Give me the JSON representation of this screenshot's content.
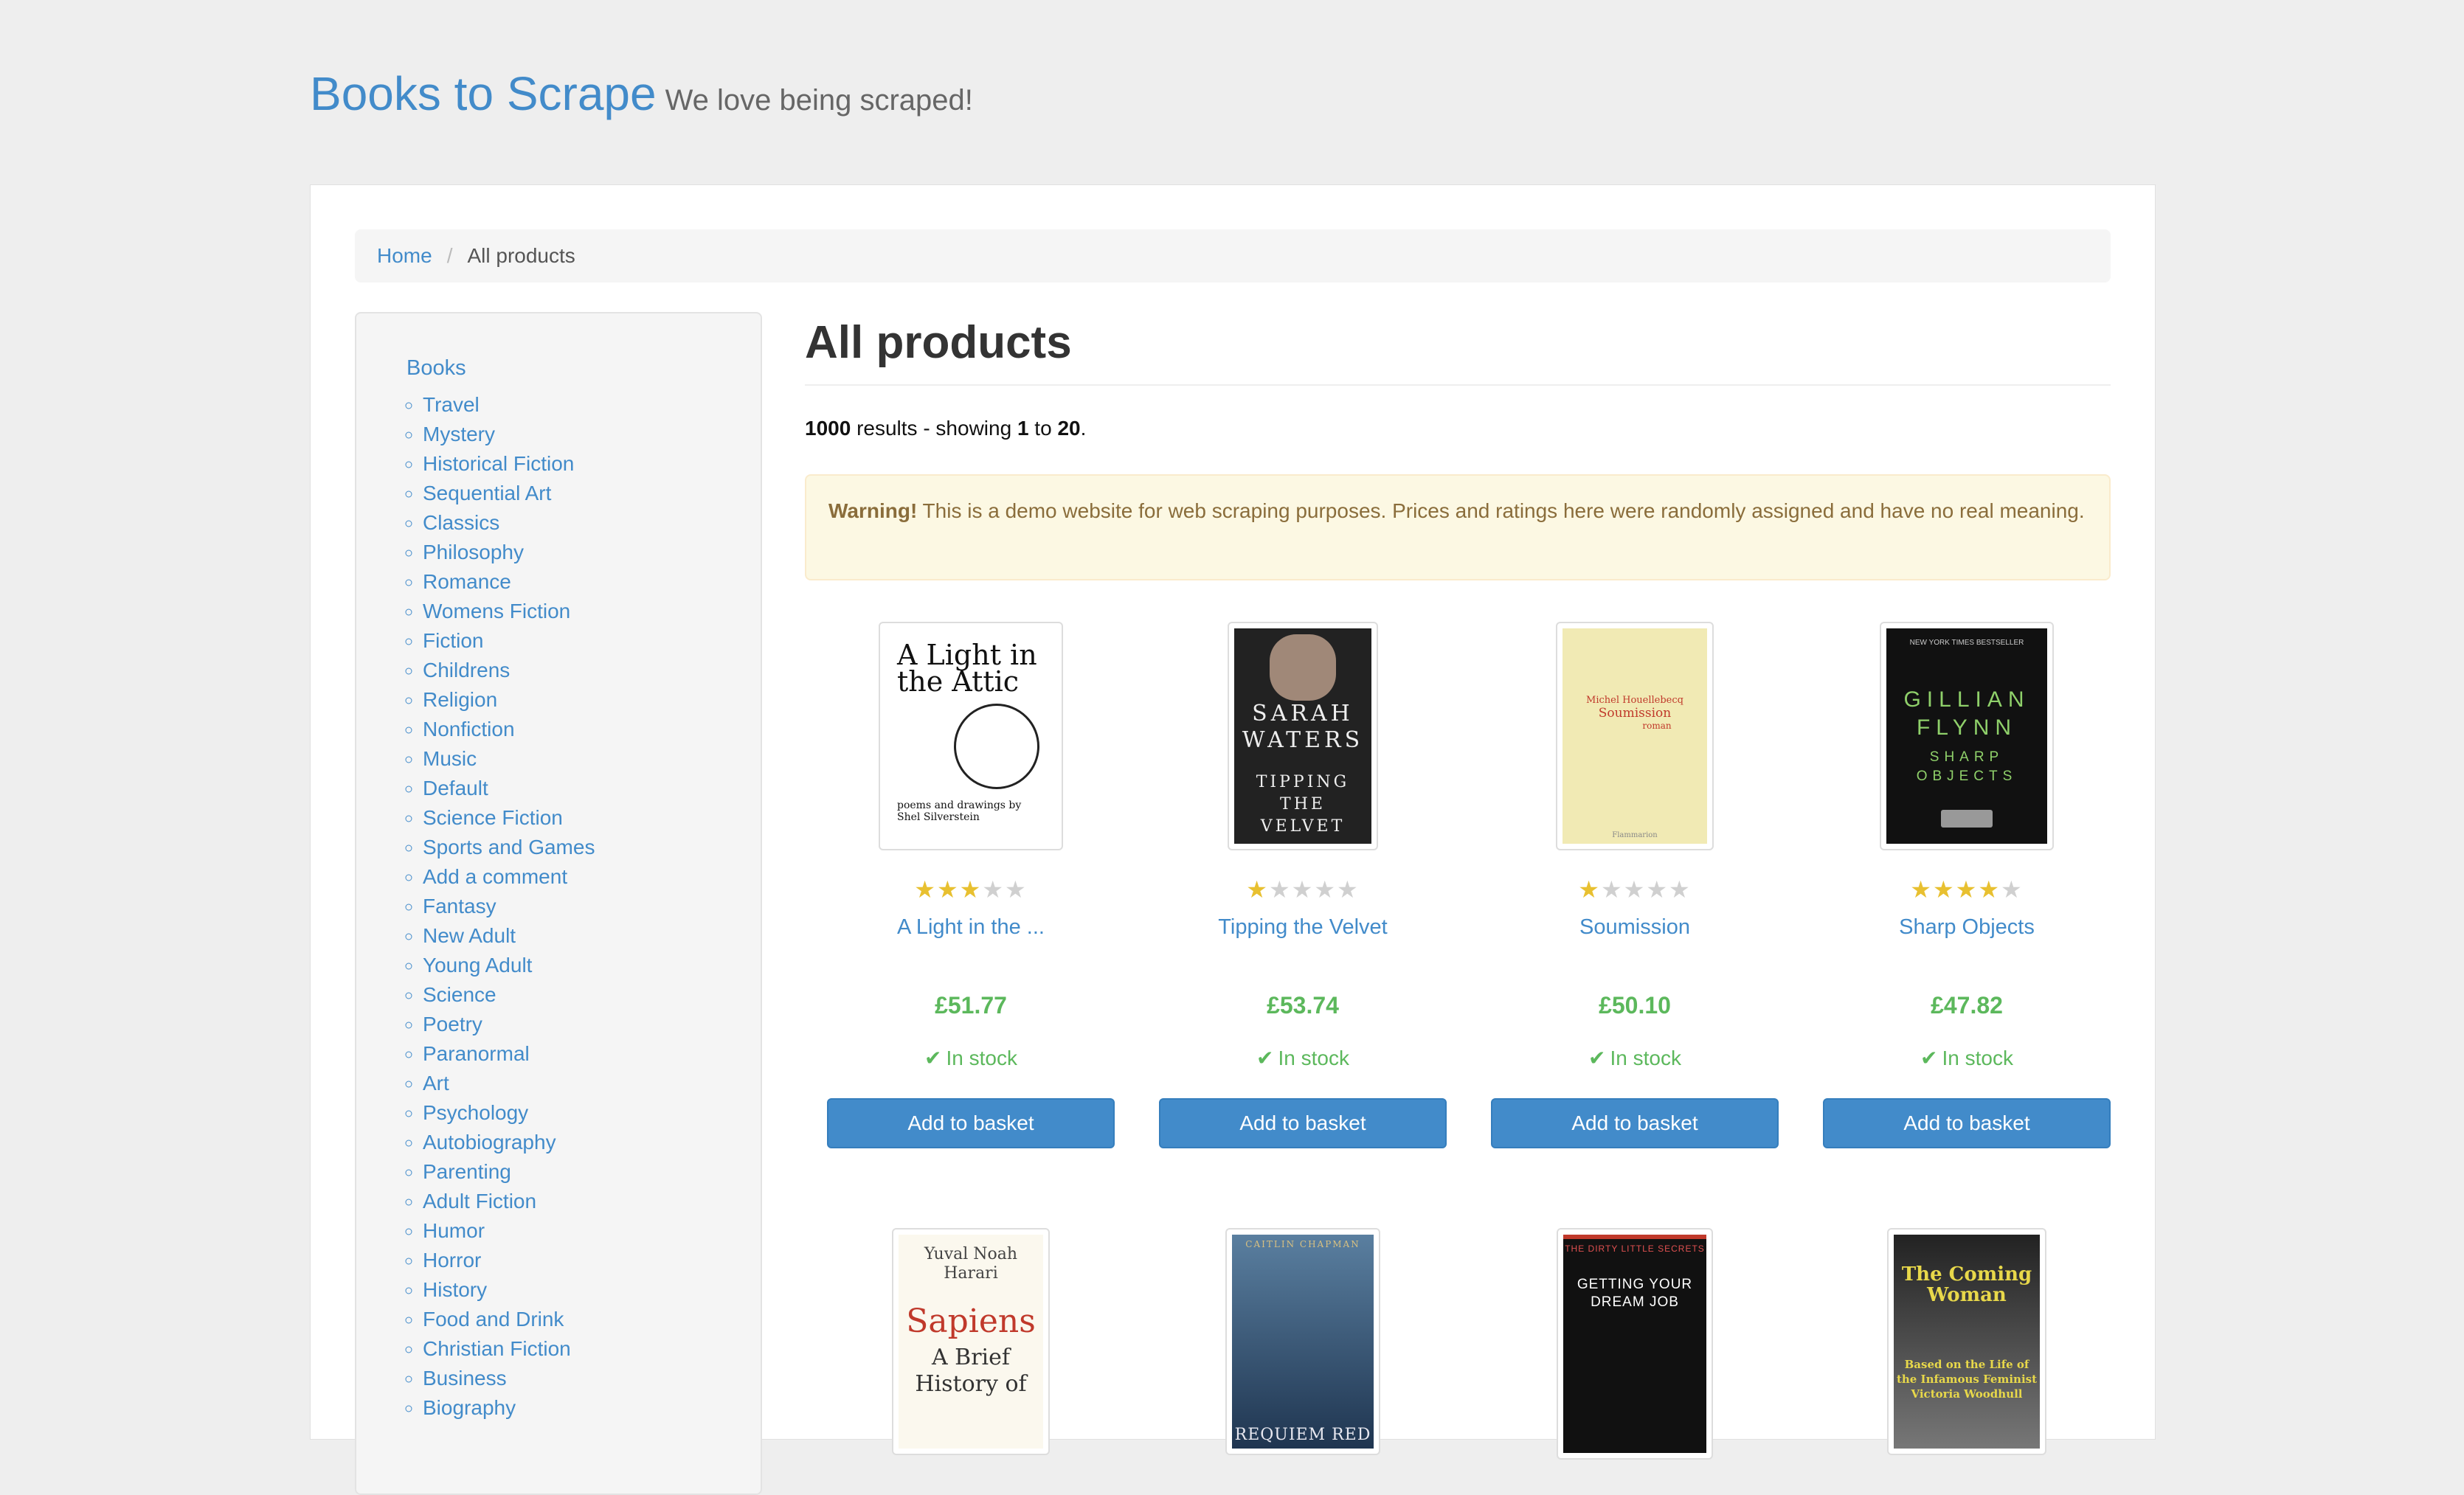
{
  "header": {
    "brand": "Books to Scrape",
    "tagline": "We love being scraped!"
  },
  "breadcrumb": {
    "home": "Home",
    "separator": "/",
    "current": "All products"
  },
  "sidebar": {
    "root": "Books",
    "categories": [
      "Travel",
      "Mystery",
      "Historical Fiction",
      "Sequential Art",
      "Classics",
      "Philosophy",
      "Romance",
      "Womens Fiction",
      "Fiction",
      "Childrens",
      "Religion",
      "Nonfiction",
      "Music",
      "Default",
      "Science Fiction",
      "Sports and Games",
      "Add a comment",
      "Fantasy",
      "New Adult",
      "Young Adult",
      "Science",
      "Poetry",
      "Paranormal",
      "Art",
      "Psychology",
      "Autobiography",
      "Parenting",
      "Adult Fiction",
      "Humor",
      "Horror",
      "History",
      "Food and Drink",
      "Christian Fiction",
      "Business",
      "Biography"
    ]
  },
  "main": {
    "title": "All products",
    "results": {
      "total": "1000",
      "text1": " results - showing ",
      "from": "1",
      "text2": " to ",
      "to": "20",
      "end": "."
    },
    "warning": {
      "label": "Warning!",
      "text": " This is a demo website for web scraping purposes. Prices and ratings here were randomly assigned and have no real meaning."
    }
  },
  "colors": {
    "link": "#428bca",
    "price": "#5cb85c",
    "star": "#e8c030",
    "warning_bg": "#fcf8e3"
  },
  "products": [
    {
      "title": "A Light in the ...",
      "rating": 3,
      "price": "£51.77",
      "stock": "In stock",
      "button": "Add to basket",
      "cover": {
        "lines": [
          "A Light in the Attic",
          "poems and drawings by Shel Silverstein"
        ]
      }
    },
    {
      "title": "Tipping the Velvet",
      "rating": 1,
      "price": "£53.74",
      "stock": "In stock",
      "button": "Add to basket",
      "cover": {
        "lines": [
          "SARAH WATERS",
          "TIPPING THE VELVET"
        ]
      }
    },
    {
      "title": "Soumission",
      "rating": 1,
      "price": "£50.10",
      "stock": "In stock",
      "button": "Add to basket",
      "cover": {
        "lines": [
          "Michel Houellebecq",
          "Soumission",
          "roman",
          "Flammarion"
        ]
      }
    },
    {
      "title": "Sharp Objects",
      "rating": 4,
      "price": "£47.82",
      "stock": "In stock",
      "button": "Add to basket",
      "cover": {
        "lines": [
          "NEW YORK TIMES BESTSELLER",
          "GILLIAN FLYNN",
          "SHARP OBJECTS"
        ]
      }
    },
    {
      "cover": {
        "lines": [
          "Yuval Noah Harari",
          "Sapiens",
          "A Brief History of"
        ]
      }
    },
    {
      "cover": {
        "lines": [
          "CAITLIN CHAPMAN",
          "REQUIEM RED"
        ]
      }
    },
    {
      "cover": {
        "lines": [
          "THE DIRTY LITTLE SECRETS",
          "GETTING YOUR DREAM JOB"
        ]
      }
    },
    {
      "cover": {
        "lines": [
          "The Coming Woman",
          "Based on the Life of the Infamous Feminist Victoria Woodhull"
        ]
      }
    }
  ]
}
